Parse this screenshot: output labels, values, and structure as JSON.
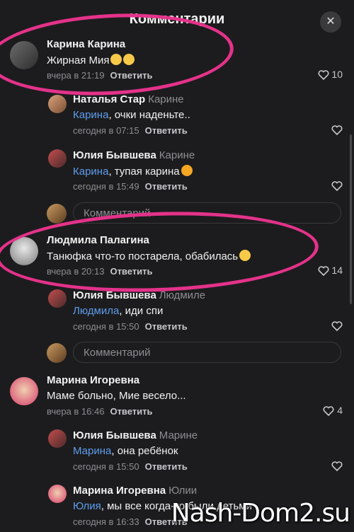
{
  "header": {
    "title": "Комментарии",
    "close": "✕"
  },
  "comments": [
    {
      "name": "Карина Карина",
      "reply_to": "",
      "mention": "",
      "text": "Жирная Мия",
      "time": "вчера в 21:19",
      "reply": "Ответить",
      "likes": "10"
    },
    {
      "name": "Наталья Стар",
      "reply_to": "Карине",
      "mention": "Карина",
      "text": ", очки наденьте..",
      "time": "сегодня в 07:15",
      "reply": "Ответить",
      "likes": ""
    },
    {
      "name": "Юлия Бывшева",
      "reply_to": "Карине",
      "mention": "Карина",
      "text": ", тупая карина",
      "time": "сегодня в 15:49",
      "reply": "Ответить",
      "likes": ""
    },
    {
      "name": "Людмила Палагина",
      "reply_to": "",
      "mention": "",
      "text": "Танюфка что-то постарела, обабилась",
      "time": "вчера в 20:13",
      "reply": "Ответить",
      "likes": "14"
    },
    {
      "name": "Юлия Бывшева",
      "reply_to": "Людмиле",
      "mention": "Людмила",
      "text": ", иди спи",
      "time": "сегодня в 15:50",
      "reply": "Ответить",
      "likes": ""
    },
    {
      "name": "Марина Игоревна",
      "reply_to": "",
      "mention": "",
      "text": "Маме больно, Мие весело...",
      "time": "вчера в 16:46",
      "reply": "Ответить",
      "likes": "4"
    },
    {
      "name": "Юлия Бывшева",
      "reply_to": "Марине",
      "mention": "Марина",
      "text": ", она ребёнок",
      "time": "сегодня в 15:50",
      "reply": "Ответить",
      "likes": ""
    },
    {
      "name": "Марина Игоревна",
      "reply_to": "Юлии",
      "mention": "Юлия",
      "text": ", мы все когда-то были детьми",
      "time": "сегодня в 16:33",
      "reply": "Ответить",
      "likes": ""
    }
  ],
  "inputs": [
    {
      "placeholder": "Комментарий"
    },
    {
      "placeholder": "Комментарий"
    }
  ],
  "watermark": "Nash-Dom2.su",
  "colors": {
    "background": "#1c1c1e",
    "mention": "#5f9ded",
    "highlight": "#e4328a"
  }
}
